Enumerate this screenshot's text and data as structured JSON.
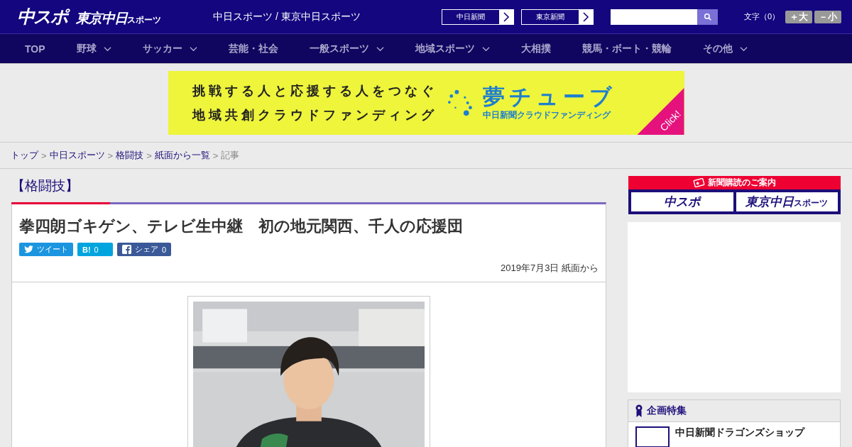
{
  "header": {
    "logo_main": "中スポ",
    "logo_sub": "東京中日",
    "logo_sub_small": "スポーツ",
    "tagline": "中日スポーツ / 東京中日スポーツ",
    "paper_links": [
      {
        "label": "中日新聞"
      },
      {
        "label": "東京新聞"
      }
    ],
    "text_size": {
      "label": "文字（0）",
      "buttons": [
        "＋大",
        "－小"
      ]
    }
  },
  "nav": [
    {
      "label": "TOP",
      "has_menu": false
    },
    {
      "label": "野球",
      "has_menu": true
    },
    {
      "label": "サッカー",
      "has_menu": true
    },
    {
      "label": "芸能・社会",
      "has_menu": false
    },
    {
      "label": "一般スポーツ",
      "has_menu": true
    },
    {
      "label": "地域スポーツ",
      "has_menu": true
    },
    {
      "label": "大相撲",
      "has_menu": false
    },
    {
      "label": "競馬・ボート・競輪",
      "has_menu": false
    },
    {
      "label": "その他",
      "has_menu": true
    }
  ],
  "banner": {
    "lines": [
      "挑戦する人と応援する人をつなぐ",
      "地域共創クラウドファンディング"
    ],
    "brand": "夢チューブ",
    "brand_sub": "中日新聞クラウドファンディング",
    "corner": "Click!"
  },
  "breadcrumb": [
    {
      "label": "トップ",
      "link": true
    },
    {
      "separator": ">",
      "label": "中日スポーツ",
      "link": true
    },
    {
      "separator": ">",
      "label": "格闘技",
      "link": true
    },
    {
      "separator": ">",
      "label": "紙面から一覧",
      "link": true
    },
    {
      "separator": ">",
      "label": "記事",
      "link": false
    }
  ],
  "article": {
    "category": "【格闘技】",
    "title": "拳四朗ゴキゲン、テレビ生中継　初の地元関西、千人の応援団",
    "share": [
      {
        "kind": "twitter",
        "label": "ツイート"
      },
      {
        "kind": "hatena",
        "label": "B!",
        "count": "0"
      },
      {
        "kind": "facebook",
        "label": "シェア",
        "count": "0"
      }
    ],
    "dateline": "2019年7月3日 紙面から"
  },
  "sidebar": {
    "subscribe": {
      "title": "新聞購読のご案内",
      "logos": [
        "中スポ",
        "東京中日"
      ],
      "logo_small": "スポーツ"
    },
    "feature": {
      "title": "企画特集",
      "items": [
        "中日新聞ドラゴンズショップ"
      ]
    }
  }
}
